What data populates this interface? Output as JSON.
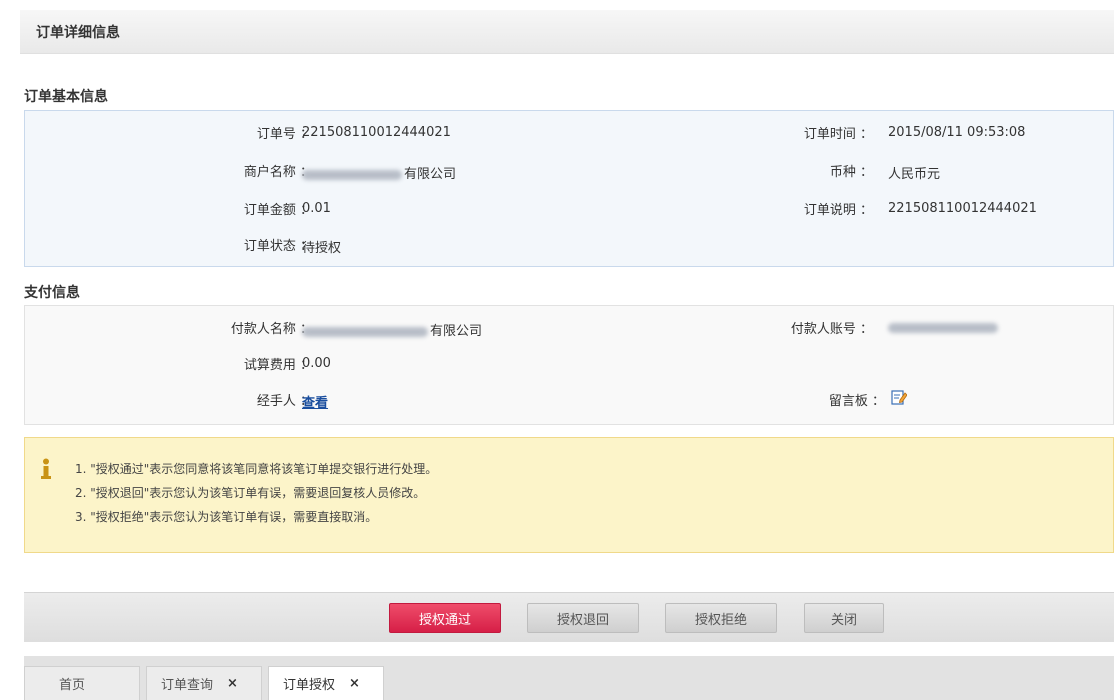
{
  "header": {
    "title": "订单详细信息"
  },
  "basic_info": {
    "title": "订单基本信息",
    "order_no_label": "订单号 ：",
    "order_no": "221508110012444021",
    "order_time_label": "订单时间 ：",
    "order_time": "2015/08/11 09:53:08",
    "merchant_label": "商户名称 ：",
    "merchant_suffix": "有限公司",
    "currency_label": "币种 ：",
    "currency": "人民币元",
    "amount_label": "订单金额 ：",
    "amount": "0.01",
    "desc_label": "订单说明 ：",
    "desc": "221508110012444021",
    "status_label": "订单状态 ：",
    "status": "待授权"
  },
  "payment_info": {
    "title": "支付信息",
    "payer_name_label": "付款人名称 ：",
    "payer_name_suffix": "有限公司",
    "payer_account_label": "付款人账号 ：",
    "fee_label": "试算费用 ：",
    "fee": "0.00",
    "handler_label": "经手人 ：",
    "handler_link": "查看",
    "message_label": "留言板 ："
  },
  "notice": {
    "lines": [
      "1. \"授权通过\"表示您同意将该笔同意将该笔订单提交银行进行处理。",
      "2. \"授权退回\"表示您认为该笔订单有误，需要退回复核人员修改。",
      "3. \"授权拒绝\"表示您认为该笔订单有误，需要直接取消。"
    ]
  },
  "actions": {
    "approve": "授权通过",
    "return": "授权退回",
    "reject": "授权拒绝",
    "close": "关闭"
  },
  "tabs": [
    {
      "label": "首页"
    },
    {
      "label": "订单查询",
      "close": "×"
    },
    {
      "label": "订单授权",
      "close": "×"
    }
  ],
  "colors": {
    "primary_button": "#d61f47",
    "notice_bg": "#fcf4c9",
    "link": "#1a4e9e"
  }
}
